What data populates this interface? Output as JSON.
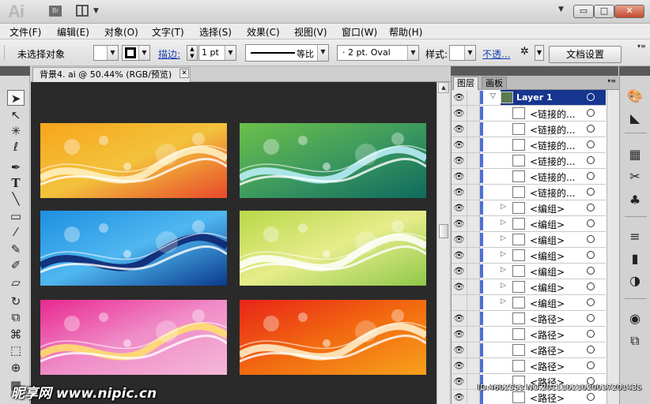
{
  "app": {
    "logo": "Ai",
    "bridge_label": "Br",
    "window_controls": {
      "minimize": "▭",
      "maximize": "□",
      "close": "✕"
    }
  },
  "menu": [
    "文件(F)",
    "编辑(E)",
    "对象(O)",
    "文字(T)",
    "选择(S)",
    "效果(C)",
    "视图(V)",
    "窗口(W)",
    "帮助(H)"
  ],
  "control": {
    "selection_status": "未选择对象",
    "stroke_label": "描边:",
    "stroke_weight": "1 pt",
    "stroke_style": "等比",
    "brush": "· 2 pt. Oval",
    "style_label": "样式:",
    "opacity_label": "不透...",
    "doc_setup_button": "文档设置"
  },
  "document": {
    "tab_title": "背景4. ai @ 50.44% (RGB/预览)",
    "close_glyph": "✕"
  },
  "thumbnails": [
    {
      "colors": [
        "#f7a51c",
        "#f3c23c",
        "#e8482a"
      ],
      "wave": "#fff3c8"
    },
    {
      "colors": [
        "#6cc04a",
        "#3d9a5e",
        "#0f6b5e"
      ],
      "wave": "#bff2ff"
    },
    {
      "colors": [
        "#1e8fe0",
        "#4fb7f0",
        "#0a3a8c"
      ],
      "wave": "#0b1f6a"
    },
    {
      "colors": [
        "#b9d84a",
        "#e6ec8a",
        "#8fc84a"
      ],
      "wave": "#ffffff"
    },
    {
      "colors": [
        "#e8288f",
        "#f08cc8",
        "#f4b8d8"
      ],
      "wave": "#ffe36a"
    },
    {
      "colors": [
        "#e82418",
        "#f26a10",
        "#f7a11c"
      ],
      "wave": "#fff3d0"
    }
  ],
  "layers_panel": {
    "tabs": [
      "图层",
      "画板"
    ],
    "menu_glyph": "▾≡",
    "layer_name": "Layer 1",
    "rows": [
      {
        "name": "<链接的...",
        "visible": true,
        "expand": false
      },
      {
        "name": "<链接的...",
        "visible": true,
        "expand": false
      },
      {
        "name": "<链接的...",
        "visible": true,
        "expand": false
      },
      {
        "name": "<链接的...",
        "visible": true,
        "expand": false
      },
      {
        "name": "<链接的...",
        "visible": true,
        "expand": false
      },
      {
        "name": "<链接的...",
        "visible": true,
        "expand": false
      },
      {
        "name": "<编组>",
        "visible": true,
        "expand": true
      },
      {
        "name": "<编组>",
        "visible": true,
        "expand": true
      },
      {
        "name": "<编组>",
        "visible": true,
        "expand": true
      },
      {
        "name": "<编组>",
        "visible": true,
        "expand": true
      },
      {
        "name": "<编组>",
        "visible": true,
        "expand": true
      },
      {
        "name": "<编组>",
        "visible": true,
        "expand": true
      },
      {
        "name": "<编组>",
        "visible": false,
        "expand": true
      },
      {
        "name": "<路径>",
        "visible": true,
        "expand": false
      },
      {
        "name": "<路径>",
        "visible": true,
        "expand": false
      },
      {
        "name": "<路径>",
        "visible": true,
        "expand": false
      },
      {
        "name": "<路径>",
        "visible": true,
        "expand": false
      },
      {
        "name": "<路径>",
        "visible": true,
        "expand": false
      },
      {
        "name": "<路径>",
        "visible": true,
        "expand": false
      },
      {
        "name": "<路径>",
        "visible": true,
        "expand": false
      }
    ]
  },
  "watermark": {
    "site": "昵享网 www.nipic.cn",
    "id": "ID:4602553 NO:20111021020037201435"
  },
  "colors": {
    "canvas": "#2a2a2a",
    "layer_highlight": "#15358f",
    "layer_color_bar": "#4f6fd6",
    "link_blue": "#1a3fb5"
  }
}
